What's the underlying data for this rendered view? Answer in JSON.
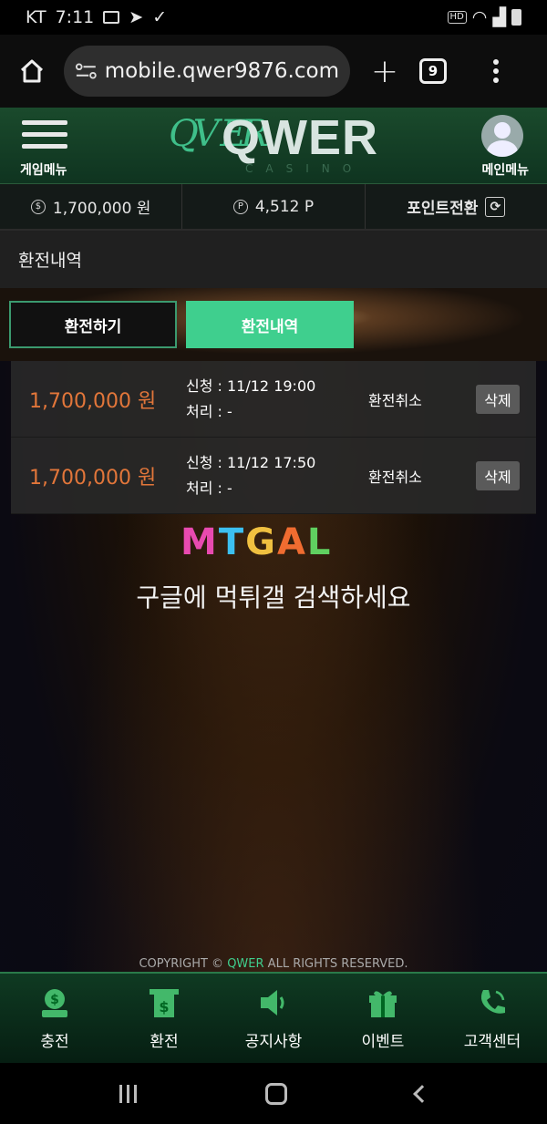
{
  "status_bar": {
    "carrier": "KT",
    "time": "7:11",
    "hd": "HD"
  },
  "browser": {
    "url": "mobile.qwer9876.com",
    "tab_count": "9"
  },
  "header": {
    "left_label": "게임메뉴",
    "right_label": "메인메뉴",
    "logo_word": "QWER",
    "logo_mark": "QV ER",
    "logo_sub": "CASINO"
  },
  "info_bar": {
    "cash": "1,700,000 원",
    "points": "4,512 P",
    "convert_label": "포인트전환"
  },
  "section_title": "환전내역",
  "tabs": [
    {
      "label": "환전하기",
      "active": false
    },
    {
      "label": "환전내역",
      "active": true
    }
  ],
  "rows": [
    {
      "amount": "1,700,000 원",
      "request": "신청 : 11/12 19:00",
      "process": "처리 : -",
      "action": "환전취소",
      "delete": "삭제"
    },
    {
      "amount": "1,700,000 원",
      "request": "신청 : 11/12 17:50",
      "process": "처리 : -",
      "action": "환전취소",
      "delete": "삭제"
    }
  ],
  "watermark": {
    "logo_letters": [
      "M",
      "T",
      "G",
      "A",
      "L"
    ],
    "text": "구글에 먹튀갤 검색하세요"
  },
  "copyright": {
    "prefix": "COPYRIGHT © ",
    "brand": "QWER",
    "suffix": " ALL RIGHTS RESERVED."
  },
  "bottom_nav": [
    {
      "label": "충전",
      "icon": "money-bag-icon"
    },
    {
      "label": "환전",
      "icon": "receipt-dollar-icon"
    },
    {
      "label": "공지사항",
      "icon": "speaker-icon"
    },
    {
      "label": "이벤트",
      "icon": "gift-icon"
    },
    {
      "label": "고객센터",
      "icon": "phone-icon"
    }
  ],
  "colors": {
    "accent": "#3fcf8e",
    "amount": "#e2763a",
    "header_green": "#1a4a2c"
  }
}
